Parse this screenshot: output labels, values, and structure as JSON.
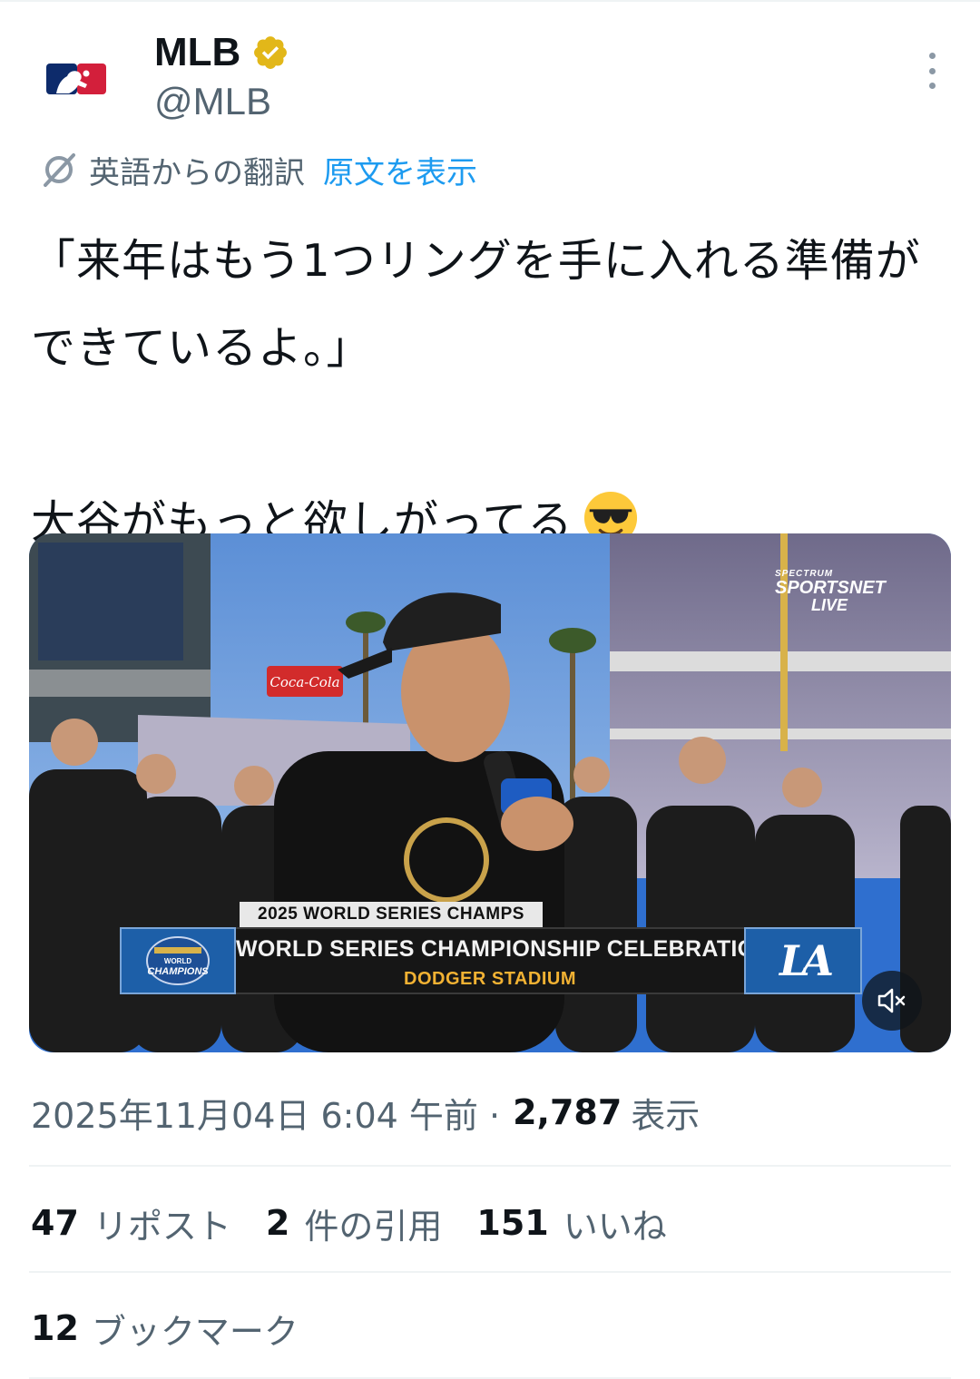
{
  "header": {
    "display_name": "MLB",
    "handle": "@MLB",
    "avatar_icon": "mlb-logo-icon",
    "verified_icon": "verified-badge-icon",
    "more_icon": "more-vertical-icon"
  },
  "translation": {
    "label": "英語からの翻訳",
    "show_original": "原文を表示"
  },
  "tweet": {
    "line1": "「来年はもう1つリングを手に入れる準備が",
    "line2": "できているよ。」",
    "line3": "大谷がもっと欲しがってる",
    "emoji": "smiling-face-with-sunglasses-icon"
  },
  "video": {
    "network_line1": "SPECTRUM",
    "network_line2": "SPORTSNET",
    "network_line3": "LIVE",
    "banner_top": "2025 WORLD SERIES CHAMPS",
    "banner_title": "WORLD SERIES CHAMPIONSHIP CELEBRATION",
    "banner_subtitle": "DODGER STADIUM",
    "champions_badge_top": "WORLD",
    "champions_badge_main": "CHAMPIONS",
    "team_logo": "LA",
    "mute_icon": "volume-muted-icon"
  },
  "meta": {
    "timestamp": "2025年11月04日 6:04 午前 ·",
    "views_count": "2,787",
    "views_label": "表示"
  },
  "stats": {
    "reposts_count": "47",
    "reposts_label": "リポスト",
    "quotes_count": "2",
    "quotes_label": "件の引用",
    "likes_count": "151",
    "likes_label": "いいね",
    "bookmarks_count": "12",
    "bookmarks_label": "ブックマーク"
  },
  "colors": {
    "accent_blue": "#1d9bf0",
    "secondary_text": "#536471",
    "primary_text": "#0f1419",
    "verified_gold": "#e2b719",
    "divider": "#eff3f4"
  }
}
